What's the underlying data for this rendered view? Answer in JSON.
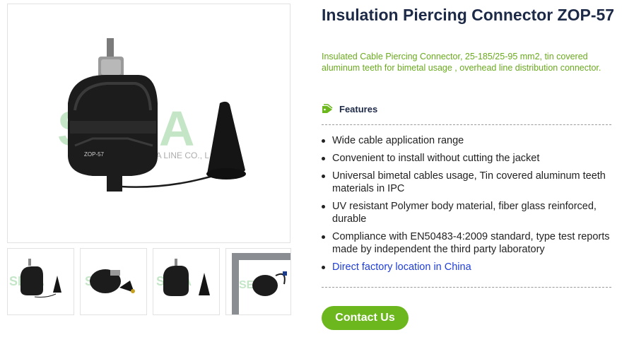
{
  "product": {
    "title": "Insulation Piercing Connector ZOP-57",
    "subtitle": "Insulated Cable Piercing Connector, 25-185/25-95 mm2, tin covered aluminum teeth for bimetal usage , overhead line distribution connector."
  },
  "gallery": {
    "watermark": "SERA",
    "watermark_sub": "SERA LINE CO., L",
    "model_mark": "ZOP-57",
    "thumbnails_count": 4
  },
  "features": {
    "heading": "Features",
    "items": [
      "Wide cable application range",
      "Convenient to install without cutting the jacket",
      "Universal bimetal cables usage, Tin covered aluminum teeth materials in IPC",
      "UV resistant Polymer body material, fiber glass reinforced, durable",
      "Compliance with EN50483-4:2009 standard, type test reports made by independent the third party laboratory"
    ],
    "link_text": "Direct factory location in China"
  },
  "cta": {
    "label": "Contact Us"
  },
  "colors": {
    "accent_green": "#6cb61e",
    "title_navy": "#1d2a47",
    "link_blue": "#1f3dd8",
    "subtitle_green": "#6aaa1e"
  },
  "icons": {
    "features": "tag-icon"
  }
}
